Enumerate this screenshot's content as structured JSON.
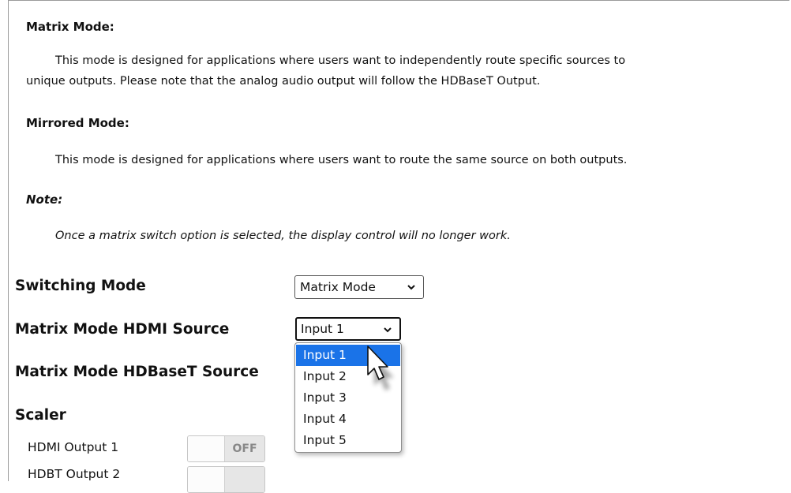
{
  "info": {
    "matrix_heading": "Matrix Mode:",
    "matrix_text_line1": "This mode is designed for applications where users want to independently route specific sources to",
    "matrix_text_line2": "unique outputs. Please note that the analog audio output will follow the HDBaseT Output.",
    "mirrored_heading": "Mirrored Mode:",
    "mirrored_text": "This mode is designed for applications where users want to route the same source on both outputs.",
    "note_heading": "Note:",
    "note_text": "Once a matrix switch option is selected, the display control will no longer work."
  },
  "settings": {
    "switching_mode_label": "Switching Mode",
    "switching_mode_value": "Matrix Mode",
    "hdmi_source_label": "Matrix Mode HDMI Source",
    "hdmi_source_value": "Input 1",
    "hdbaset_source_label": "Matrix Mode HDBaseT Source",
    "hdmi_source_options": [
      "Input 1",
      "Input 2",
      "Input 3",
      "Input 4",
      "Input 5"
    ],
    "highlighted_option": "Input 1"
  },
  "scaler": {
    "heading": "Scaler",
    "items": [
      {
        "label": "HDMI Output 1",
        "state": "OFF"
      },
      {
        "label": "HDBT Output 2",
        "state": ""
      }
    ]
  },
  "colors": {
    "highlight": "#1a73e8"
  },
  "icons": {
    "dropdown_chevron": "chevron-down-icon",
    "cursor": "mouse-pointer-icon"
  }
}
